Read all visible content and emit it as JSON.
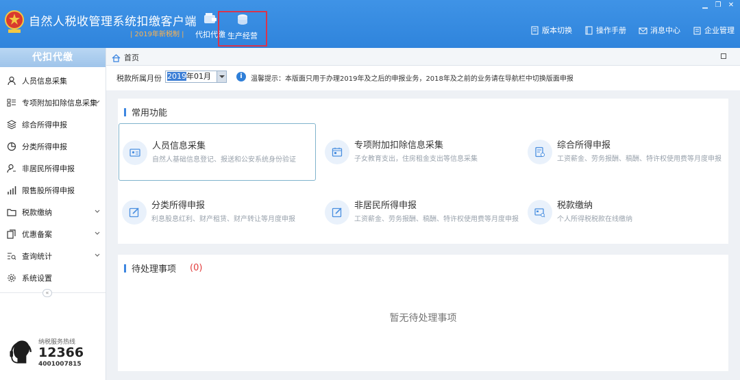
{
  "header": {
    "title": "自然人税收管理系统扣缴客户端",
    "subtitle": "| 2019年新税制 |",
    "nav": [
      {
        "label": "代扣代缴",
        "icon": "wallet-icon",
        "active": false
      },
      {
        "label": "生产经营",
        "icon": "coins-icon",
        "active": true
      }
    ],
    "links": [
      {
        "label": "版本切换",
        "icon": "document-icon"
      },
      {
        "label": "操作手册",
        "icon": "book-icon"
      },
      {
        "label": "消息中心",
        "icon": "mail-icon"
      },
      {
        "label": "企业管理",
        "icon": "building-icon"
      }
    ],
    "window_controls": [
      "minimize-icon",
      "restore-icon",
      "close-icon"
    ]
  },
  "sidebar": {
    "title": "代扣代缴",
    "items": [
      {
        "label": "人员信息采集",
        "icon": "person-icon",
        "expandable": false
      },
      {
        "label": "专项附加扣除信息采集",
        "icon": "list-icon",
        "expandable": true
      },
      {
        "label": "综合所得申报",
        "icon": "layers-icon",
        "expandable": false
      },
      {
        "label": "分类所得申报",
        "icon": "pie-chart-icon",
        "expandable": false
      },
      {
        "label": "非居民所得申报",
        "icon": "user-icon",
        "expandable": false
      },
      {
        "label": "限售股所得申报",
        "icon": "bar-chart-icon",
        "expandable": false
      },
      {
        "label": "税款缴纳",
        "icon": "folder-icon",
        "expandable": true
      },
      {
        "label": "优惠备案",
        "icon": "copy-icon",
        "expandable": true
      },
      {
        "label": "查询统计",
        "icon": "search-list-icon",
        "expandable": true
      },
      {
        "label": "系统设置",
        "icon": "gear-icon",
        "expandable": false
      }
    ],
    "collapse_glyph": "«",
    "hotline": {
      "label": "纳税服务热线",
      "number": "12366",
      "sub": "4001007815"
    }
  },
  "breadcrumb": {
    "label": "首页",
    "icon": "home-icon"
  },
  "filter": {
    "period_label": "税款所属月份",
    "period_value_sel": "2019",
    "period_value_rest": "年01月",
    "notice": "温馨提示：本版面只用于办理2019年及之后的申报业务，2018年及之前的业务请在导航栏中切换版面申报"
  },
  "common": {
    "title": "常用功能",
    "cards": [
      {
        "title": "人员信息采集",
        "desc": "自然人基础信息登记、报送和公安系统身份验证",
        "icon": "id-card-icon",
        "highlighted": true
      },
      {
        "title": "专项附加扣除信息采集",
        "desc": "子女教育支出，住房租金支出等信息采集",
        "icon": "calendar-icon",
        "highlighted": false
      },
      {
        "title": "综合所得申报",
        "desc": "工资薪金、劳务报酬、稿酬、特许权使用费等月度申报",
        "icon": "form-icon",
        "highlighted": false
      },
      {
        "title": "分类所得申报",
        "desc": "利息股息红利、财产租赁、财产转让等月度申报",
        "icon": "edit-icon",
        "highlighted": false
      },
      {
        "title": "非居民所得申报",
        "desc": "工资薪金、劳务报酬、稿酬、特许权使用费等月度申报",
        "icon": "edit-icon",
        "highlighted": false
      },
      {
        "title": "税款缴纳",
        "desc": "个人所得税税款在线缴纳",
        "icon": "payment-icon",
        "highlighted": false
      }
    ]
  },
  "pending": {
    "title": "待处理事项",
    "count": "(0)",
    "empty": "暂无待处理事项"
  },
  "colors": {
    "header_blue": "#3f93e6",
    "accent": "#3d86e0",
    "highlight_red": "#d9344c",
    "count_red": "#e23b3b"
  }
}
